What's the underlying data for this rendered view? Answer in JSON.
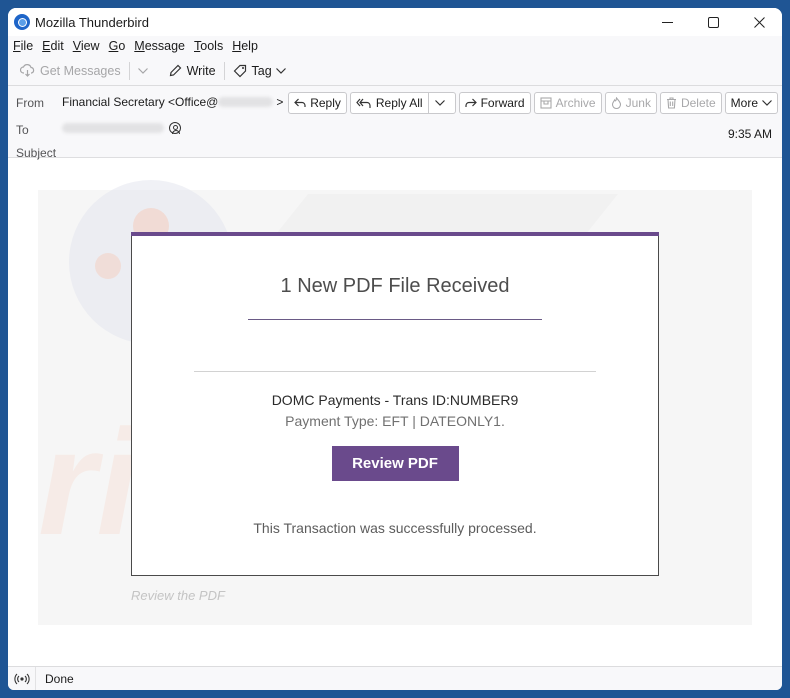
{
  "window": {
    "title": "Mozilla Thunderbird",
    "controls": [
      "minimize",
      "maximize",
      "close"
    ]
  },
  "menu": {
    "items": [
      {
        "label": "File",
        "accel": "F"
      },
      {
        "label": "Edit",
        "accel": "E"
      },
      {
        "label": "View",
        "accel": "V"
      },
      {
        "label": "Go",
        "accel": "G"
      },
      {
        "label": "Message",
        "accel": "M"
      },
      {
        "label": "Tools",
        "accel": "T"
      },
      {
        "label": "Help",
        "accel": "H"
      }
    ]
  },
  "toolbar": {
    "get_messages": "Get Messages",
    "write": "Write",
    "tag": "Tag"
  },
  "header": {
    "from_label": "From",
    "from_name": "Financial Secretary <Office@",
    "from_suffix": ">",
    "to_label": "To",
    "subject_label": "Subject",
    "subject": "",
    "time": "9:35 AM",
    "actions": {
      "reply": "Reply",
      "reply_all": "Reply All",
      "forward": "Forward",
      "archive": "Archive",
      "junk": "Junk",
      "delete": "Delete",
      "more": "More"
    }
  },
  "email": {
    "title": "1 New PDF File Received",
    "transaction": "DOMC Payments - Trans ID:NUMBER9",
    "payment_type": "Payment Type: EFT | DATEONLY1.",
    "button": "Review PDF",
    "processed": "This Transaction was successfully processed.",
    "footer_link": "Review the PDF",
    "accent_color": "#6a4a8c"
  },
  "status": {
    "text": "Done"
  }
}
